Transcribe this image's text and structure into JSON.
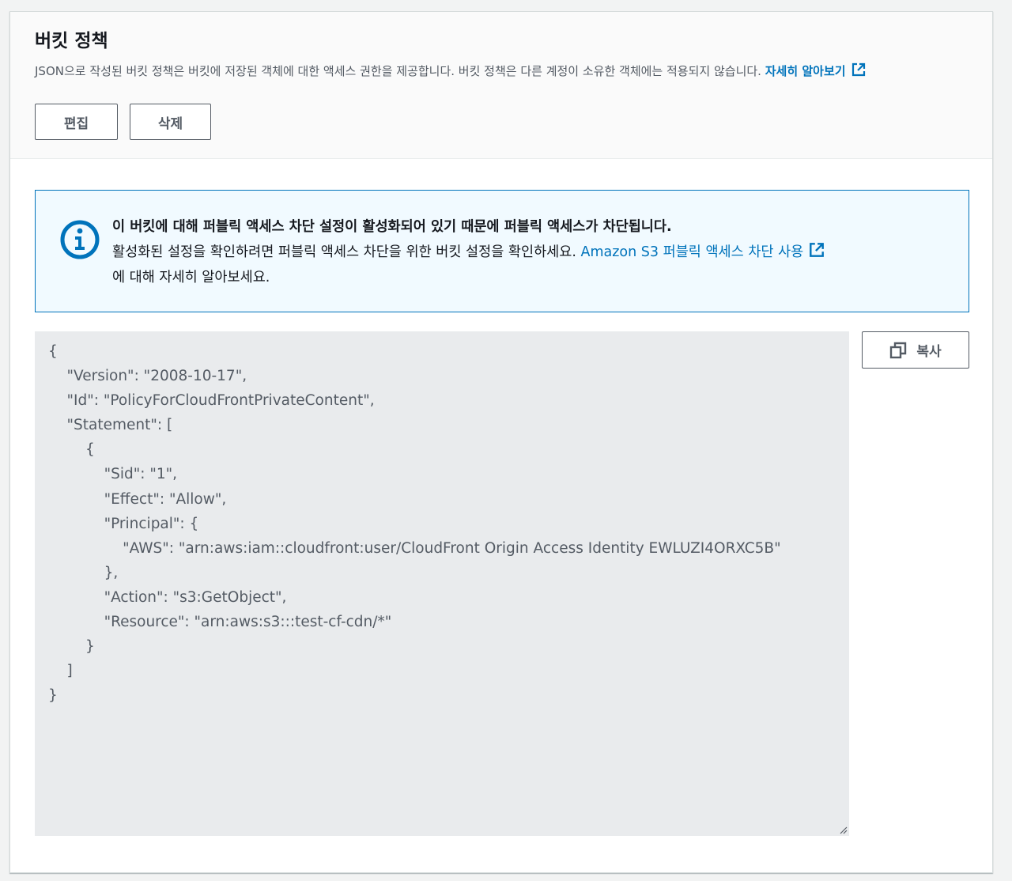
{
  "header": {
    "title": "버킷 정책",
    "description": "JSON으로 작성된 버킷 정책은 버킷에 저장된 객체에 대한 액세스 권한을 제공합니다. 버킷 정책은 다른 계정이 소유한 객체에는 적용되지 않습니다.",
    "learn_more_link": "자세히 알아보기",
    "edit_label": "편집",
    "delete_label": "삭제"
  },
  "info_alert": {
    "title": "이 버킷에 대해 퍼블릭 액세스 차단 설정이 활성화되어 있기 때문에 퍼블릭 액세스가 차단됩니다.",
    "body": "활성화된 설정을 확인하려면 퍼블릭 액세스 차단을 위한 버킷 설정을 확인하세요. ",
    "link": "Amazon S3 퍼블릭 액세스 차단 사용",
    "body_after": "에 대해 자세히 알아보세요."
  },
  "policy": {
    "text": "{\n    \"Version\": \"2008-10-17\",\n    \"Id\": \"PolicyForCloudFrontPrivateContent\",\n    \"Statement\": [\n        {\n            \"Sid\": \"1\",\n            \"Effect\": \"Allow\",\n            \"Principal\": {\n                \"AWS\": \"arn:aws:iam::cloudfront:user/CloudFront Origin Access Identity EWLUZI4ORXC5B\"\n            },\n            \"Action\": \"s3:GetObject\",\n            \"Resource\": \"arn:aws:s3:::test-cf-cdn/*\"\n        }\n    ]\n}",
    "copy_label": "복사"
  },
  "colors": {
    "link": "#0073bb",
    "info_border": "#0073bb",
    "info_background": "#f1faff",
    "code_background": "#e9ebed"
  },
  "icons": {
    "external_link": "external-link-icon",
    "info": "info-icon",
    "copy": "copy-icon"
  }
}
